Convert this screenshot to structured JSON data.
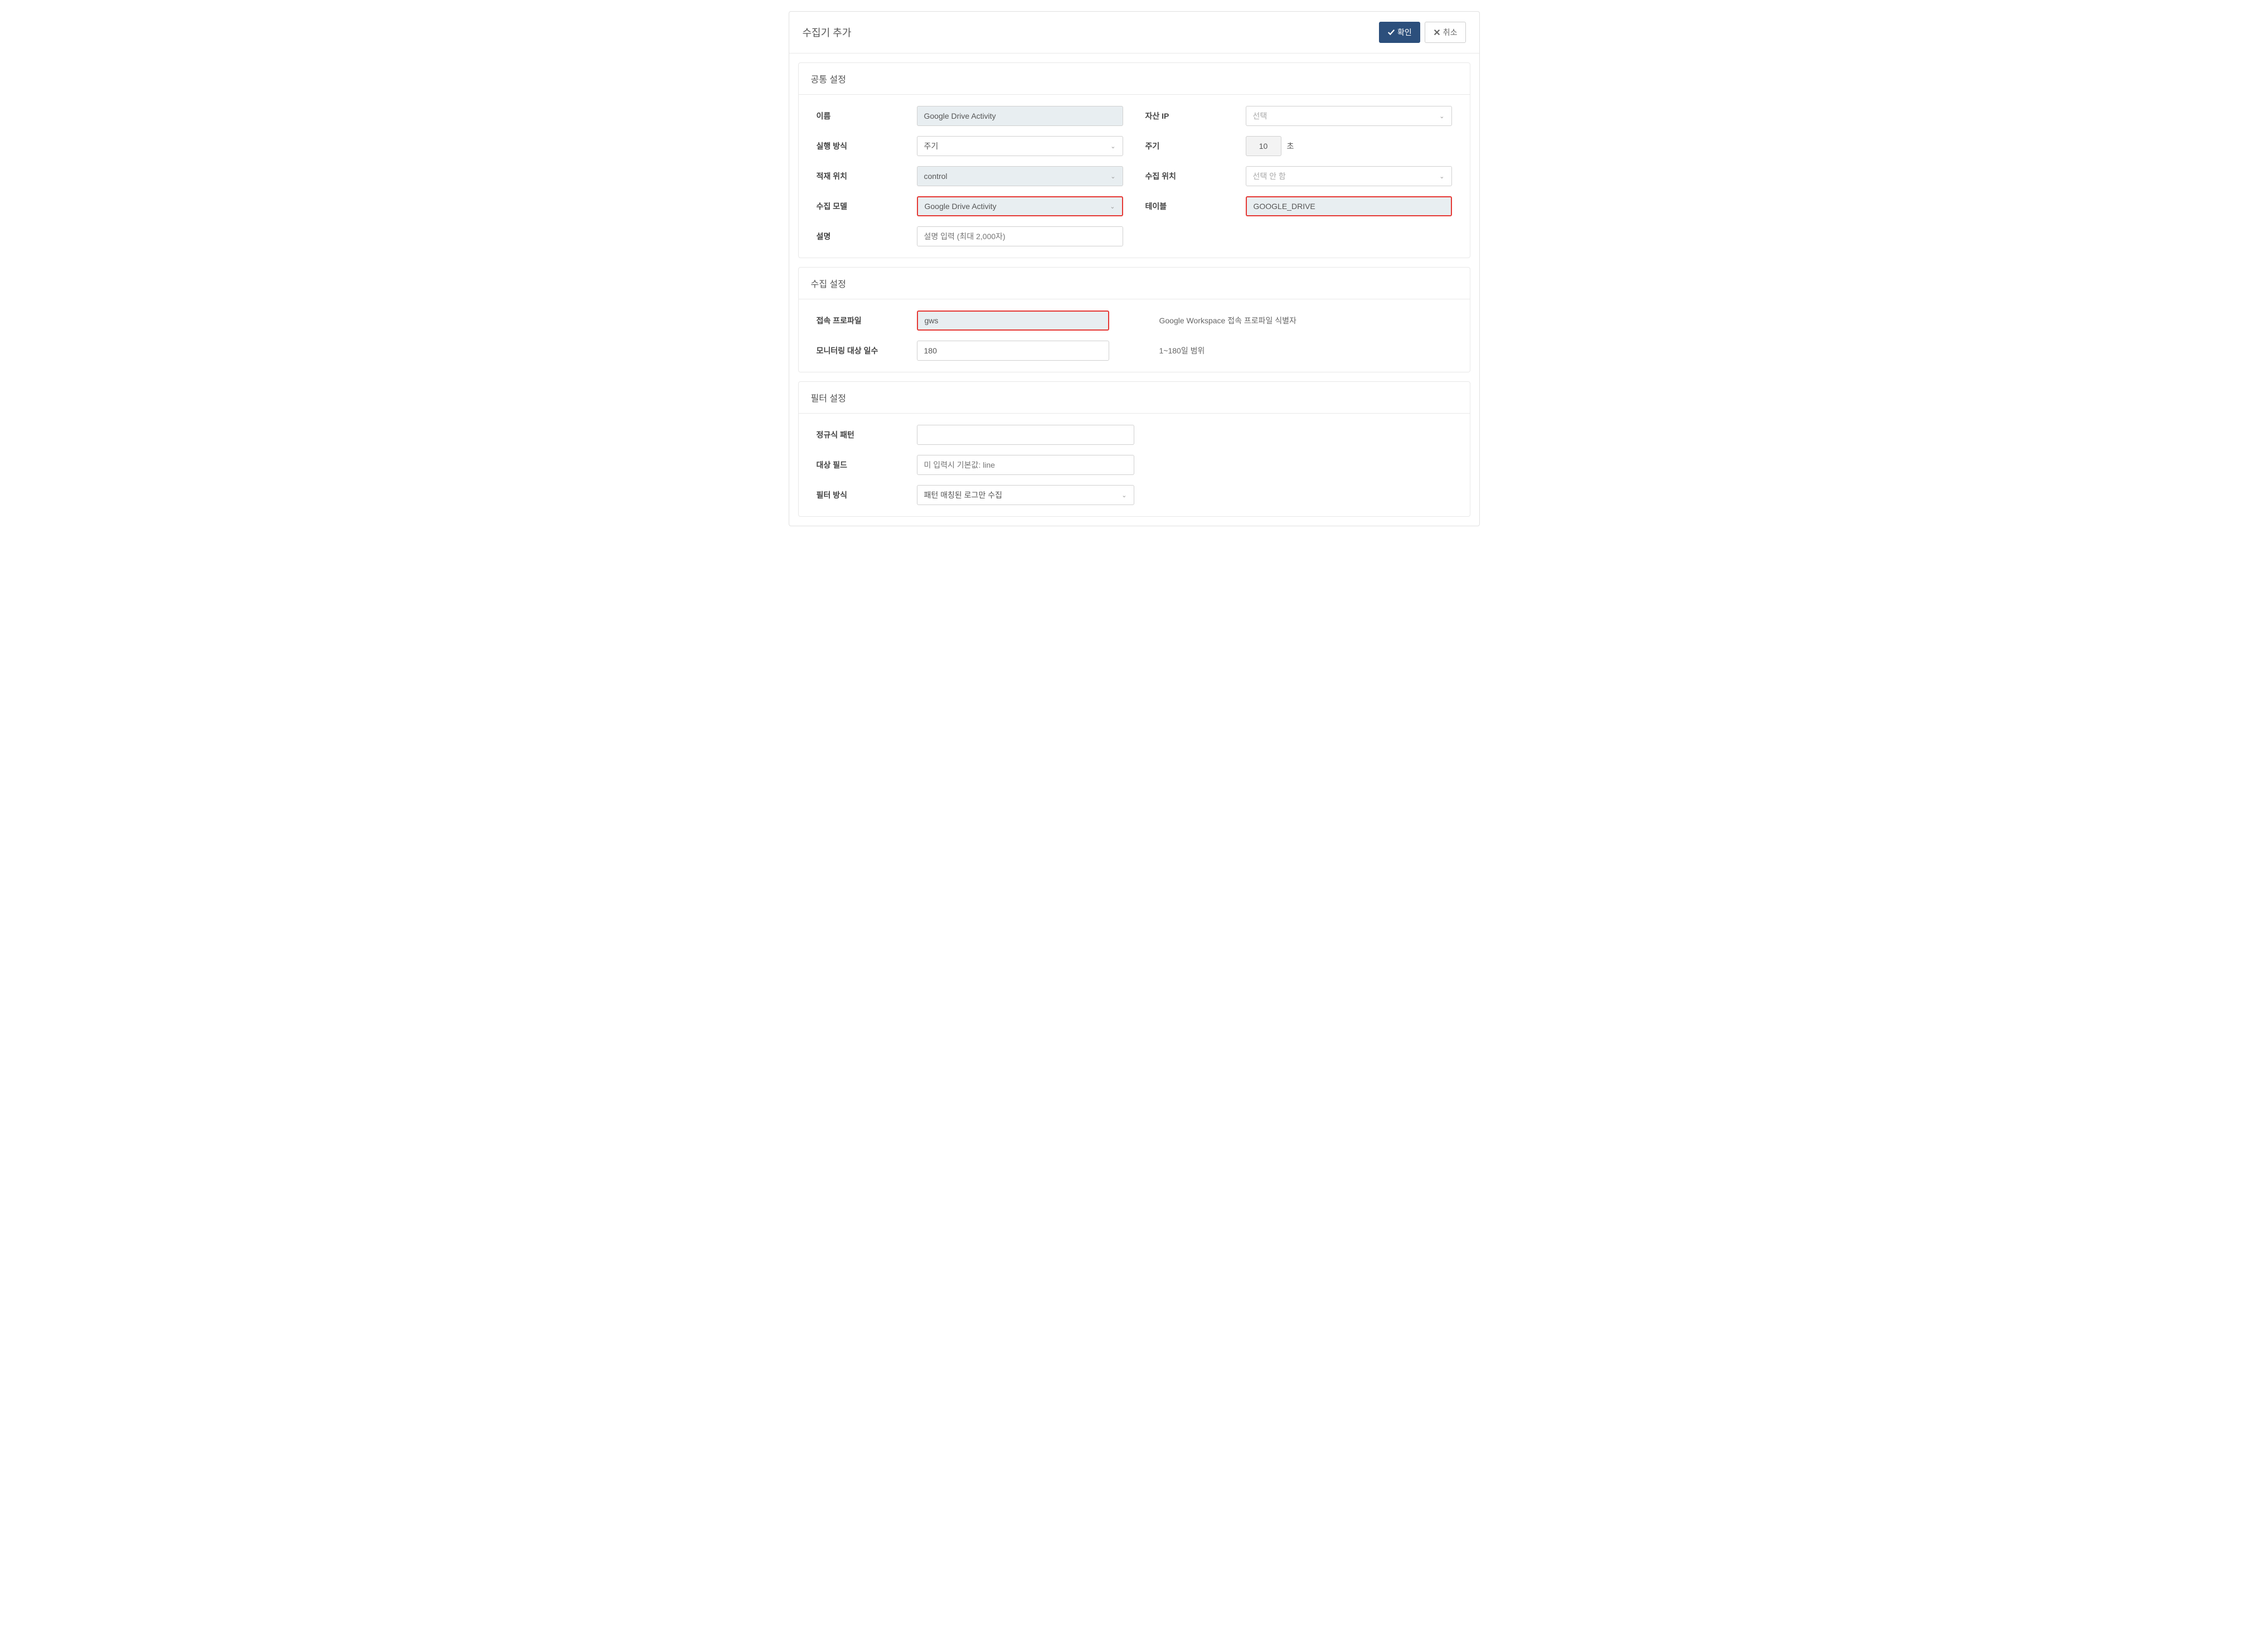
{
  "dialog": {
    "title": "수집기 추가",
    "confirm_label": "확인",
    "cancel_label": "취소"
  },
  "sections": {
    "common": {
      "title": "공통 설정",
      "name_label": "이름",
      "name_value": "Google Drive Activity",
      "asset_ip_label": "자산 IP",
      "asset_ip_placeholder": "선택",
      "exec_mode_label": "실행 방식",
      "exec_mode_value": "주기",
      "interval_label": "주기",
      "interval_value": "10",
      "interval_unit": "초",
      "load_loc_label": "적재 위치",
      "load_loc_value": "control",
      "collect_loc_label": "수집 위치",
      "collect_loc_placeholder": "선택 안 함",
      "model_label": "수집 모델",
      "model_value": "Google Drive Activity",
      "table_label": "테이블",
      "table_value": "GOOGLE_DRIVE",
      "desc_label": "설명",
      "desc_placeholder": "설명 입력 (최대 2,000자)"
    },
    "collect": {
      "title": "수집 설정",
      "profile_label": "접속 프로파일",
      "profile_value": "gws",
      "profile_help": "Google Workspace 접속 프로파일 식별자",
      "days_label": "모니터링 대상 일수",
      "days_value": "180",
      "days_help": "1~180일 범위"
    },
    "filter": {
      "title": "필터 설정",
      "regex_label": "정규식 패턴",
      "regex_value": "",
      "field_label": "대상 필드",
      "field_placeholder": "미 입력시 기본값: line",
      "mode_label": "필터 방식",
      "mode_value": "패턴 매칭된 로그만 수집"
    }
  }
}
